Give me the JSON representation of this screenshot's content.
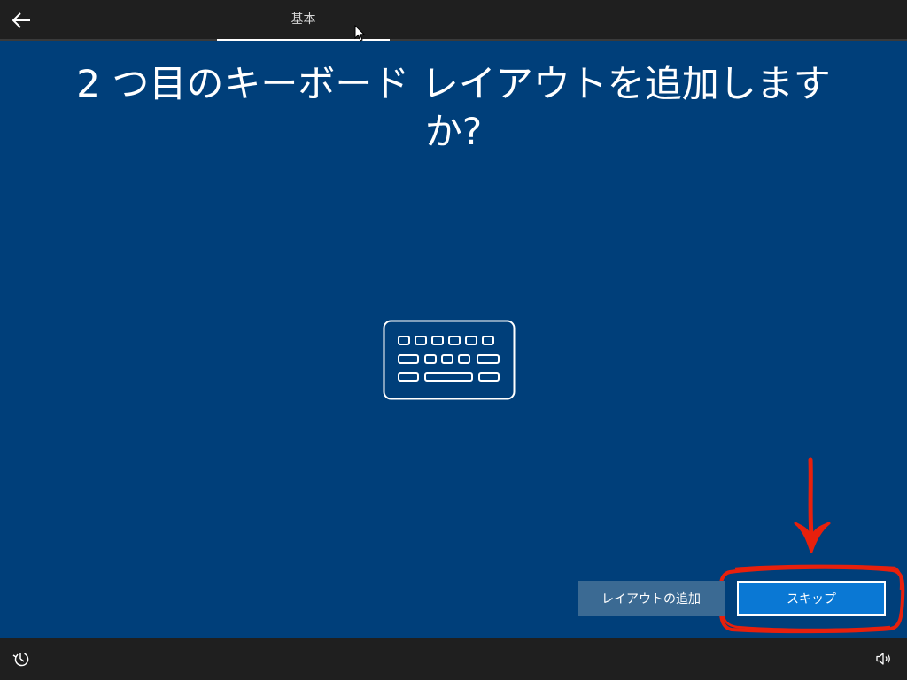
{
  "header": {
    "tab_label": "基本"
  },
  "main": {
    "title_line1": "2 つ目のキーボード レイアウトを追加します",
    "title_line2": "か?"
  },
  "actions": {
    "add_layout_label": "レイアウトの追加",
    "skip_label": "スキップ"
  },
  "icons": {
    "back": "back-arrow-icon",
    "keyboard": "keyboard-icon",
    "annotation_arrow": "annotation-arrow-icon",
    "accessibility": "accessibility-icon",
    "volume": "volume-icon"
  },
  "colors": {
    "background": "#003f7a",
    "bar": "#1f1f1f",
    "primary_button": "#0a78d4",
    "secondary_button": "#3b6a93",
    "annotation": "#e8200c"
  }
}
